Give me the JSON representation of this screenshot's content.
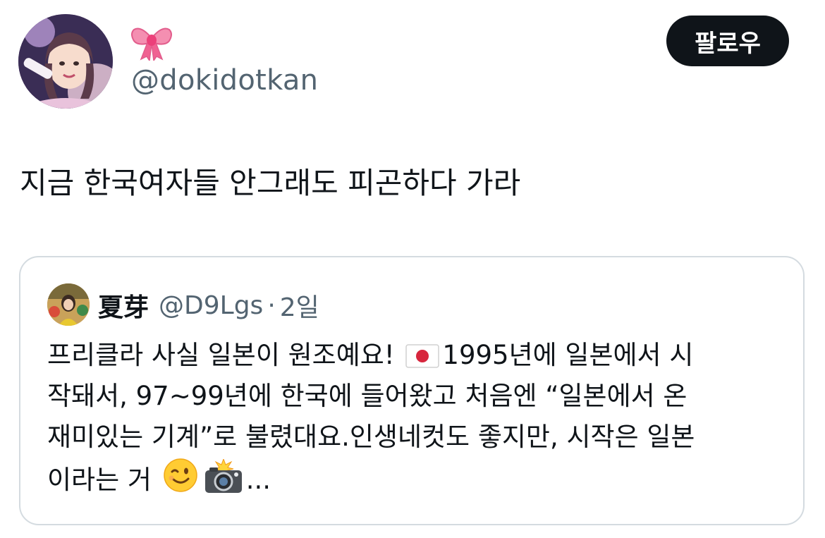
{
  "author": {
    "display_name_emoji": "ribbon",
    "handle": "@dokidotkan"
  },
  "follow_button": {
    "label": "팔로우"
  },
  "tweet": {
    "text": "지금 한국여자들 안그래도 피곤하다 가라"
  },
  "quoted_tweet": {
    "author_name": "夏芽",
    "author_handle": "@D9Lgs",
    "separator": "·",
    "time_ago": "2일",
    "lines": {
      "l1a": "프리클라 사실 일본이 원조예요! ",
      "l1b": "1995년에 일본에서 시",
      "l2": "작돼서, 97~99년에 한국에 들어왔고 처음엔 “일본에서 온",
      "l3": "재미있는 기계”로 불렸대요.인생네컷도 좋지만, 시작은 일본",
      "l4a": "이라는 거 ",
      "l4b": "..."
    },
    "emojis": [
      "japan-flag",
      "winking-face",
      "camera-with-flash"
    ]
  },
  "colors": {
    "text_primary": "#0f1419",
    "text_secondary": "#536471",
    "button_bg": "#0f1419",
    "card_border": "#d4dbe0"
  }
}
